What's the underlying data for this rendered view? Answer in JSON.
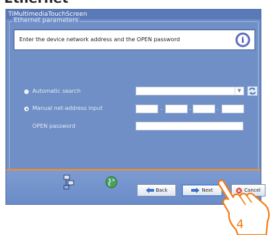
{
  "page": {
    "heading": "Ethernet"
  },
  "window": {
    "title": "TiMultimediaTouchScreen"
  },
  "group": {
    "label": "Ethernet parameters"
  },
  "info": {
    "text": "Enter the device network address and the OPEN password"
  },
  "options": {
    "automatic_search": "Automatic search",
    "manual_input": "Manual net-address input",
    "open_password": "OPEN password",
    "selected": "manual"
  },
  "ip": {
    "separator": "."
  },
  "buttons": {
    "back": "Back",
    "next": "Next",
    "cancel": "Cancel"
  },
  "annotation": {
    "step": "4"
  },
  "colors": {
    "window_bg": "#6f8fc6",
    "divider": "#ff8a1e",
    "hand_outline": "#f07c14"
  }
}
